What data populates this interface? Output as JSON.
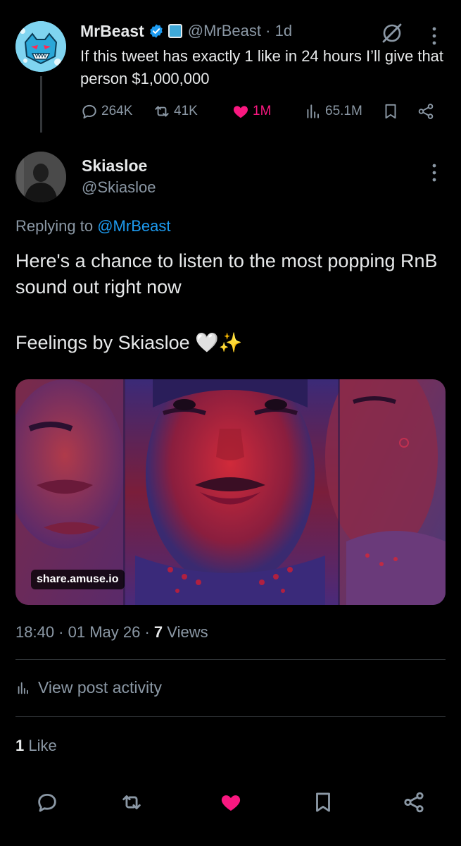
{
  "parent_tweet": {
    "author_name": "MrBeast",
    "handle": "@MrBeast",
    "age": "1d",
    "text": "If this tweet has exactly 1 like in 24 hours I’ll give that person $1,000,000",
    "stats": {
      "replies": "264K",
      "reposts": "41K",
      "likes": "1M",
      "views": "65.1M"
    },
    "liked": true,
    "colors": {
      "like": "#f91880",
      "verified": "#1d9bf0"
    }
  },
  "reply_tweet": {
    "author_name": "Skiasloe",
    "handle": "@Skiasloe",
    "replying_prefix": "Replying to",
    "replying_mention": "@MrBeast",
    "body_line1": "Here's a chance to listen to the most popping RnB sound out right now",
    "body_line2": "Feelings by Skiasloe 🤍✨",
    "card_domain": "share.amuse.io",
    "time": "18:40",
    "date": "01 May 26",
    "views_count": "7",
    "views_label": "Views",
    "activity_label": "View post activity",
    "like_count": "1",
    "like_label": "Like"
  },
  "icons": {
    "reply": "reply-icon",
    "repost": "repost-icon",
    "like": "heart-icon",
    "views": "views-icon",
    "bookmark": "bookmark-icon",
    "share": "share-icon",
    "more": "more-vertical-icon",
    "grok": "grok-icon"
  }
}
